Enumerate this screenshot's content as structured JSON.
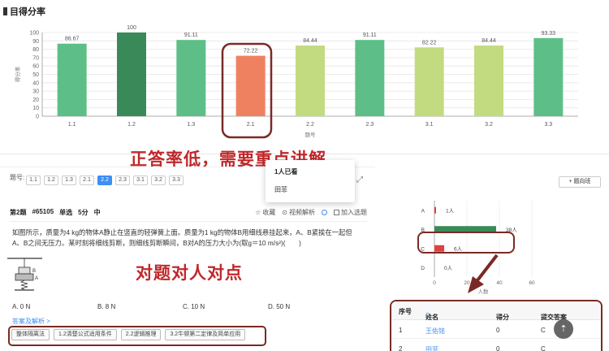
{
  "panel": {
    "title": "目得分率"
  },
  "chart_data": {
    "type": "bar",
    "categories": [
      "1.1",
      "1.2",
      "1.3",
      "2.1",
      "2.2",
      "2.3",
      "3.1",
      "3.2",
      "3.3"
    ],
    "values": [
      86.67,
      100,
      91.11,
      72.22,
      84.44,
      91.11,
      82.22,
      84.44,
      93.33
    ],
    "value_labels": [
      "86.67",
      "100",
      "91.11",
      "72.22",
      "84.44",
      "91.11",
      "82.22",
      "84.44",
      "93.33"
    ],
    "bar_colors": [
      "#5dbf87",
      "#3a8a59",
      "#5dbf87",
      "#ef8160",
      "#c3db80",
      "#5dbf87",
      "#c3db80",
      "#c3db80",
      "#5dbf87"
    ],
    "xlabel": "题号",
    "ylabel": "得分率",
    "ylim": [
      0,
      100
    ],
    "yticks": [
      "0",
      "10",
      "20",
      "30",
      "40",
      "50",
      "60",
      "70",
      "80",
      "90",
      "100"
    ],
    "highlighted": "2.1"
  },
  "callouts": {
    "top": "正答率低，需要重点讲解",
    "middle": "对题对人对点"
  },
  "question_tabs": {
    "label": "题号:",
    "items": [
      "1.1",
      "1.2",
      "1.3",
      "2.1",
      "2.2",
      "2.3",
      "3.1",
      "3.2",
      "3.3"
    ],
    "active": "2.2"
  },
  "dropdown": {
    "title": "1人已看",
    "item": "田菲"
  },
  "question": {
    "number": "第2题",
    "id": "#65105",
    "type": "单选",
    "score": "5分",
    "difficulty": "中",
    "favorite": "收藏",
    "video": "视频解析",
    "add_basket": "加入选题",
    "text": "如图所示，质量为4 kg的物体A静止在竖直的轻弹簧上面。质量为1 kg的物体B用细线悬挂起来，A、B紧挨在一起但A、B之间无压力。某时刻将细线剪断，则细线剪断瞬间，B对A的压力大小为(取g＝10 m/s²)(　　)",
    "figure_labels": {
      "a": "A",
      "b": "B"
    },
    "options": [
      "A. 0 N",
      "B. 8 N",
      "C. 10 N",
      "D. 50 N"
    ],
    "analysis_link": "答案及解析 >",
    "tags": [
      "整体隔离法",
      "1.2清楚公式适用条件",
      "2.2逻辑推理",
      "3.2牛顿第二定律及简单应用"
    ]
  },
  "right_panel": {
    "class_button": "+ 题向班",
    "answer_chart": {
      "type": "bar",
      "orientation": "horizontal",
      "categories": [
        "A",
        "B",
        "C",
        "D"
      ],
      "values": [
        1,
        38,
        6,
        0
      ],
      "value_labels": [
        "1人",
        "38人",
        "6人",
        "0人"
      ],
      "colors": [
        "#e04040",
        "#3a8a59",
        "#e04040",
        "#cccccc"
      ],
      "xticks": [
        "0",
        "20",
        "40",
        "60"
      ],
      "xlim": [
        0,
        60
      ],
      "xlabel": "人数"
    },
    "table": {
      "headers": [
        "序号",
        "姓名",
        "得分",
        "提交答案"
      ],
      "rows": [
        {
          "index": "1",
          "name": "王佑铭",
          "score": "0",
          "answer": "C"
        },
        {
          "index": "2",
          "name": "田菲",
          "score": "0",
          "answer": "C"
        }
      ]
    }
  }
}
